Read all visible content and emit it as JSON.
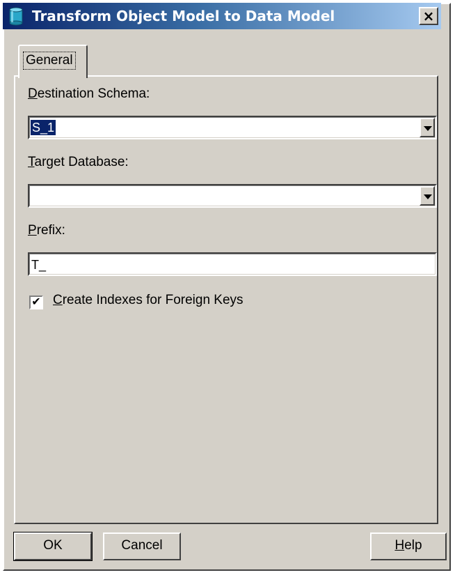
{
  "window": {
    "title": "Transform Object Model to Data Model",
    "close_glyph": "×"
  },
  "tabs": [
    {
      "label": "General",
      "selected": true
    }
  ],
  "form": {
    "destination_schema": {
      "label_accel": "D",
      "label_rest": "estination Schema:",
      "value": "S_1"
    },
    "target_database": {
      "label_accel": "T",
      "label_rest": "arget Database:",
      "value": ""
    },
    "prefix": {
      "label_accel": "P",
      "label_rest": "refix:",
      "value": "T_"
    },
    "create_indexes": {
      "label_accel": "C",
      "label_rest": "reate Indexes for Foreign Keys",
      "checked": true,
      "check_glyph": "✔"
    }
  },
  "buttons": {
    "ok": "OK",
    "cancel": "Cancel",
    "help_accel": "H",
    "help_rest": "elp"
  },
  "colors": {
    "dialog_face": "#d4d0c8",
    "title_gradient_start": "#0a246a",
    "title_gradient_end": "#a6caf0",
    "selection": "#0a246a"
  },
  "icons": {
    "title": "database-cylinder-icon",
    "close": "close-icon",
    "dropdown": "chevron-down-icon",
    "check": "checkmark-icon"
  }
}
